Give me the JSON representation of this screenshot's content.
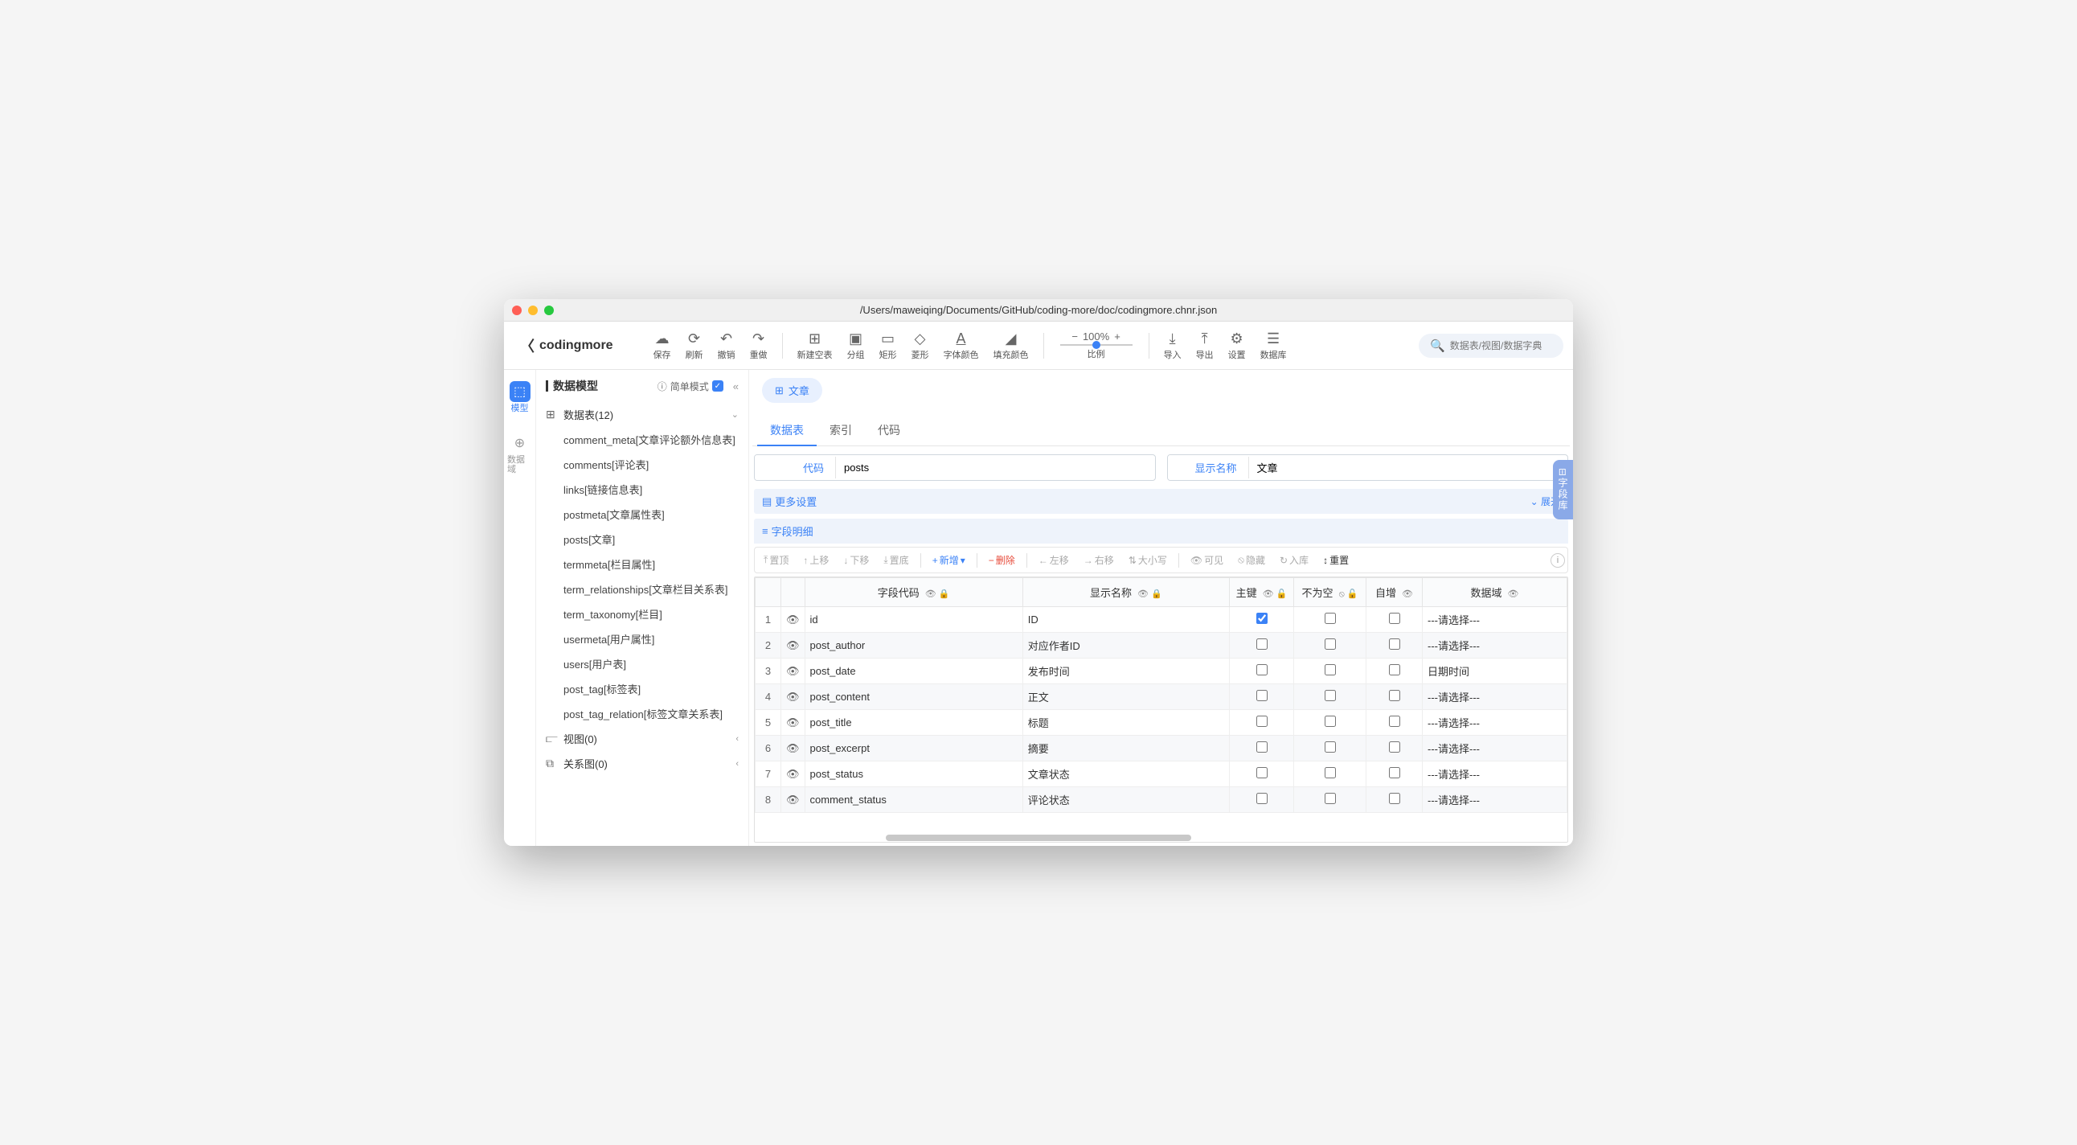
{
  "titlebar": {
    "path": "/Users/maweiqing/Documents/GitHub/coding-more/doc/codingmore.chnr.json"
  },
  "toolbar": {
    "back_label": "codingmore",
    "save": "保存",
    "refresh": "刷新",
    "undo": "撤销",
    "redo": "重做",
    "newtable": "新建空表",
    "group": "分组",
    "rect": "矩形",
    "diamond": "菱形",
    "fontcolor": "字体颜色",
    "fillcolor": "填充颜色",
    "zoom_value": "100%",
    "zoom_label": "比例",
    "import": "导入",
    "export": "导出",
    "settings": "设置",
    "database": "数据库",
    "search_placeholder": "数据表/视图/数据字典"
  },
  "rail": {
    "model": "模型",
    "domain": "数据域"
  },
  "sidebar": {
    "title": "数据模型",
    "mode_label": "简单模式",
    "groups": {
      "tables": "数据表(12)",
      "views": "视图(0)",
      "diagrams": "关系图(0)"
    },
    "tables": [
      "comment_meta[文章评论额外信息表]",
      "comments[评论表]",
      "links[链接信息表]",
      "postmeta[文章属性表]",
      "posts[文章]",
      "termmeta[栏目属性]",
      "term_relationships[文章栏目关系表]",
      "term_taxonomy[栏目]",
      "usermeta[用户属性]",
      "users[用户表]",
      "post_tag[标签表]",
      "post_tag_relation[标签文章关系表]"
    ]
  },
  "content": {
    "active_tab_label": "文章",
    "subtabs": {
      "data": "数据表",
      "index": "索引",
      "code": "代码"
    },
    "form": {
      "code_label": "代码",
      "code_value": "posts",
      "name_label": "显示名称",
      "name_value": "文章"
    },
    "more_settings": "更多设置",
    "expand": "展开",
    "fields_title": "字段明细",
    "field_toolbar": {
      "top": "置顶",
      "up": "上移",
      "down": "下移",
      "bottom": "置底",
      "add": "新增",
      "delete": "删除",
      "left": "左移",
      "right": "右移",
      "case": "大小写",
      "visible": "可见",
      "hidden": "隐藏",
      "tostore": "入库",
      "reset": "重置"
    },
    "columns": {
      "code": "字段代码",
      "name": "显示名称",
      "pk": "主键",
      "notnull": "不为空",
      "autoinc": "自增",
      "domain": "数据域"
    },
    "rows": [
      {
        "n": "1",
        "code": "id",
        "name": "ID",
        "pk": true,
        "notnull": false,
        "autoinc": false,
        "domain": "---请选择---"
      },
      {
        "n": "2",
        "code": "post_author",
        "name": "对应作者ID",
        "pk": false,
        "notnull": false,
        "autoinc": false,
        "domain": "---请选择---"
      },
      {
        "n": "3",
        "code": "post_date",
        "name": "发布时间",
        "pk": false,
        "notnull": false,
        "autoinc": false,
        "domain": "日期时间"
      },
      {
        "n": "4",
        "code": "post_content",
        "name": "正文",
        "pk": false,
        "notnull": false,
        "autoinc": false,
        "domain": "---请选择---"
      },
      {
        "n": "5",
        "code": "post_title",
        "name": "标题",
        "pk": false,
        "notnull": false,
        "autoinc": false,
        "domain": "---请选择---"
      },
      {
        "n": "6",
        "code": "post_excerpt",
        "name": "摘要",
        "pk": false,
        "notnull": false,
        "autoinc": false,
        "domain": "---请选择---"
      },
      {
        "n": "7",
        "code": "post_status",
        "name": "文章状态",
        "pk": false,
        "notnull": false,
        "autoinc": false,
        "domain": "---请选择---"
      },
      {
        "n": "8",
        "code": "comment_status",
        "name": "评论状态",
        "pk": false,
        "notnull": false,
        "autoinc": false,
        "domain": "---请选择---"
      }
    ]
  },
  "right_rail": "字段库"
}
